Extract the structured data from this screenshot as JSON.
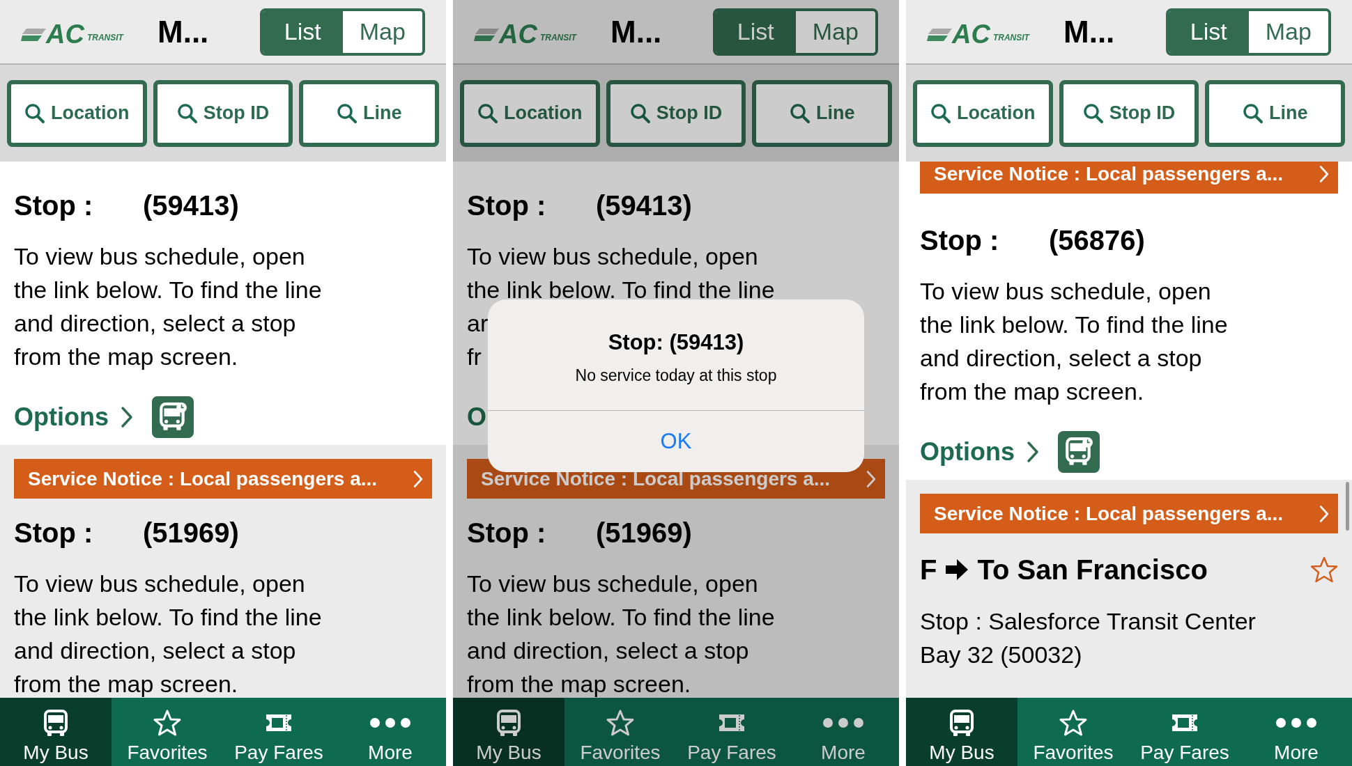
{
  "screens": [
    {
      "logo": {
        "letters": "AC",
        "word": "TRANSIT"
      },
      "title": "M...",
      "dimmed": false,
      "scroll_indicator": false,
      "view_toggle": [
        {
          "label": "List",
          "selected": true
        },
        {
          "label": "Map",
          "selected": false
        }
      ],
      "search_buttons": [
        "Location",
        "Stop ID",
        "Line"
      ],
      "items": [
        {
          "kind": "stop",
          "highlighted": true,
          "label": "Stop :",
          "stop_id": "(59413)",
          "lines": [
            "To view bus schedule, open",
            "the link below. To find the line",
            "and direction, select a stop",
            "from the map screen."
          ],
          "options": {
            "label": "Options",
            "chevron": true,
            "schedule_icon": true
          }
        },
        {
          "kind": "notice",
          "highlighted": false,
          "text": "Service Notice : Local passengers a..."
        },
        {
          "kind": "stop",
          "highlighted": false,
          "label": "Stop :",
          "stop_id": "(51969)",
          "lines": [
            "To view bus schedule, open",
            "the link below. To find the line",
            "and direction, select a stop",
            "from the map screen."
          ]
        }
      ],
      "tabs": [
        {
          "label": "My Bus",
          "selected": true
        },
        {
          "label": "Favorites",
          "selected": false
        },
        {
          "label": "Pay Fares",
          "selected": false
        },
        {
          "label": "More",
          "selected": false
        }
      ]
    },
    {
      "logo": {
        "letters": "AC",
        "word": "TRANSIT"
      },
      "title": "M...",
      "dimmed": true,
      "scroll_indicator": false,
      "view_toggle": [
        {
          "label": "List",
          "selected": true
        },
        {
          "label": "Map",
          "selected": false
        }
      ],
      "search_buttons": [
        "Location",
        "Stop ID",
        "Line"
      ],
      "items": [
        {
          "kind": "stop",
          "highlighted": true,
          "label": "Stop :",
          "stop_id": "(59413)",
          "lines": [
            "To view bus schedule, open",
            "the link below. To find the line",
            "ar",
            "fr"
          ],
          "options": {
            "label": "O"
          }
        },
        {
          "kind": "notice",
          "highlighted": false,
          "text": "Service Notice : Local passengers a..."
        },
        {
          "kind": "stop",
          "highlighted": false,
          "label": "Stop :",
          "stop_id": "(51969)",
          "lines": [
            "To view bus schedule, open",
            "the link below. To find the line",
            "and direction, select a stop",
            "from the map screen."
          ]
        }
      ],
      "dialog": {
        "title": "Stop: (59413)",
        "message": "No service today at this stop",
        "button": "OK"
      },
      "tabs": [
        {
          "label": "My Bus",
          "selected": true
        },
        {
          "label": "Favorites",
          "selected": false
        },
        {
          "label": "Pay Fares",
          "selected": false
        },
        {
          "label": "More",
          "selected": false
        }
      ]
    },
    {
      "logo": {
        "letters": "AC",
        "word": "TRANSIT"
      },
      "title": "M...",
      "dimmed": false,
      "scroll_indicator": true,
      "view_toggle": [
        {
          "label": "List",
          "selected": true
        },
        {
          "label": "Map",
          "selected": false
        }
      ],
      "search_buttons": [
        "Location",
        "Stop ID",
        "Line"
      ],
      "items": [
        {
          "kind": "notice",
          "highlighted": true,
          "text": "Service Notice : Local passengers a..."
        },
        {
          "kind": "stop",
          "highlighted": true,
          "label": "Stop :",
          "stop_id": "(56876)",
          "lines": [
            "To view bus schedule, open",
            "the link below. To find the line",
            "and direction, select a stop",
            "from the map screen."
          ],
          "options": {
            "label": "Options",
            "chevron": true,
            "schedule_icon": true
          }
        },
        {
          "kind": "notice",
          "highlighted": false,
          "text": "Service Notice : Local passengers a..."
        },
        {
          "kind": "route",
          "highlighted": false,
          "line": "F",
          "destination": "To San Francisco",
          "favorite": false,
          "stop_lines": [
            "Stop : Salesforce Transit Center",
            "Bay 32 (50032)"
          ]
        }
      ],
      "tabs": [
        {
          "label": "My Bus",
          "selected": true
        },
        {
          "label": "Favorites",
          "selected": false
        },
        {
          "label": "Pay Fares",
          "selected": false
        },
        {
          "label": "More",
          "selected": false
        }
      ]
    }
  ]
}
